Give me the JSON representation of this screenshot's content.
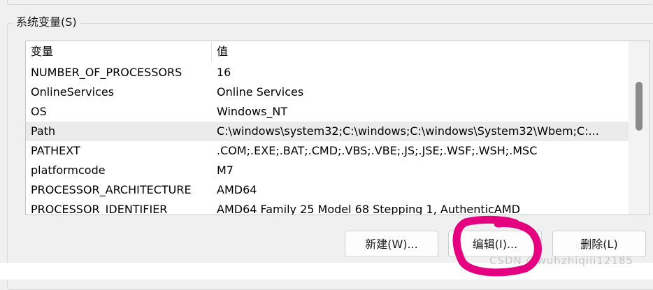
{
  "group": {
    "title": "系统变量(S)"
  },
  "table": {
    "columns": [
      "变量",
      "值"
    ],
    "rows": [
      {
        "name": "NUMBER_OF_PROCESSORS",
        "value": "16"
      },
      {
        "name": "OnlineServices",
        "value": "Online Services"
      },
      {
        "name": "OS",
        "value": "Windows_NT"
      },
      {
        "name": "Path",
        "value": "C:\\windows\\system32;C:\\windows;C:\\windows\\System32\\Wbem;C:...",
        "selected": true
      },
      {
        "name": "PATHEXT",
        "value": ".COM;.EXE;.BAT;.CMD;.VBS;.VBE;.JS;.JSE;.WSF;.WSH;.MSC"
      },
      {
        "name": "platformcode",
        "value": "M7"
      },
      {
        "name": "PROCESSOR_ARCHITECTURE",
        "value": "AMD64"
      },
      {
        "name": "PROCESSOR_IDENTIFIER",
        "value": "AMD64 Family 25 Model 68 Stepping 1, AuthenticAMD"
      }
    ]
  },
  "buttons": {
    "new": "新建(W)...",
    "edit": "编辑(I)...",
    "delete": "删除(L)"
  },
  "watermark": "CSDN @wuhzhiqiii12185",
  "colors": {
    "annotation": "#e4007f"
  },
  "icons": {
    "annotation": "hand-drawn-circle-annotation"
  }
}
